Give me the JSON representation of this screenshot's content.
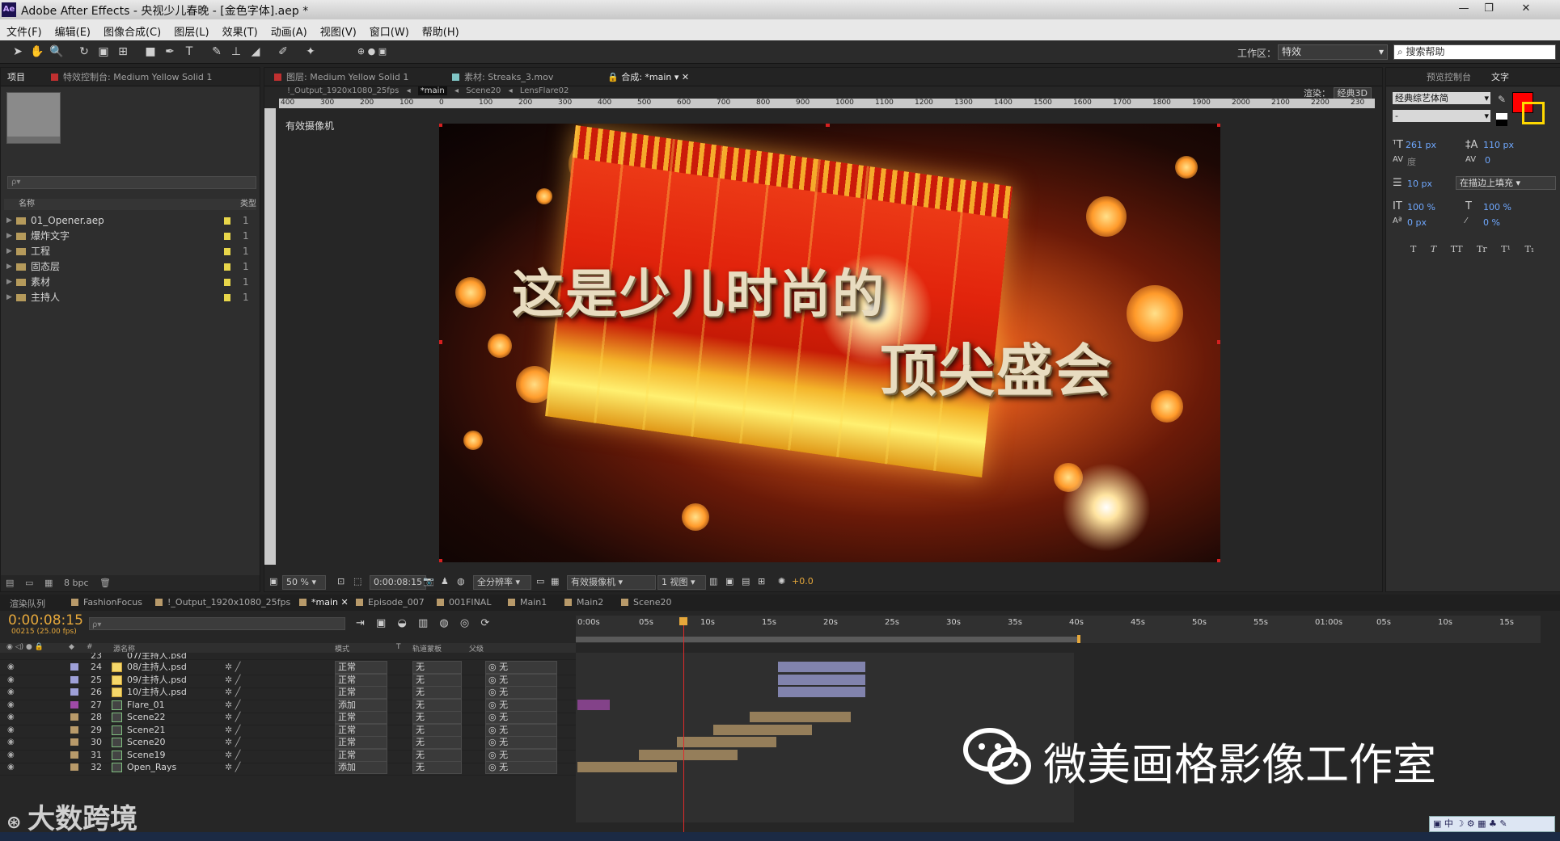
{
  "window": {
    "app_abbr": "Ae",
    "title": "Adobe After Effects - 央视少儿春晚 - [金色字体].aep *",
    "min": "—",
    "max": "❐",
    "close": "✕"
  },
  "menu": [
    "文件(F)",
    "编辑(E)",
    "图像合成(C)",
    "图层(L)",
    "效果(T)",
    "动画(A)",
    "视图(V)",
    "窗口(W)",
    "帮助(H)"
  ],
  "toolbar": {
    "workspace_label": "工作区：",
    "workspace_value": "特效",
    "help_search": "搜索帮助"
  },
  "project_panel": {
    "tab_project": "项目",
    "tab_effects": "特效控制台: Medium Yellow Solid 1",
    "search_placeholder": "ρ▾",
    "col_name": "名称",
    "col_type": "类型",
    "items": [
      {
        "name": "01_Opener.aep",
        "type": "1"
      },
      {
        "name": "爆炸文字",
        "type": "1"
      },
      {
        "name": "工程",
        "type": "1"
      },
      {
        "name": "固态层",
        "type": "1"
      },
      {
        "name": "素材",
        "type": "1"
      },
      {
        "name": "主持人",
        "type": "1"
      }
    ],
    "bpc": "8 bpc"
  },
  "viewer": {
    "tab_layer": "图层: Medium Yellow Solid 1",
    "tab_footage": "素材: Streaks_3.mov",
    "tab_comp": "合成: *main",
    "breadcrumbs": [
      "!_Output_1920x1080_25fps",
      "*main",
      "Scene20",
      "LensFlare02"
    ],
    "renderer_label": "渲染：",
    "renderer_value": "经典3D",
    "camera_label": "有效摄像机",
    "ruler_ticks": [
      "400",
      "300",
      "200",
      "100",
      "0",
      "100",
      "200",
      "300",
      "400",
      "500",
      "600",
      "700",
      "800",
      "900",
      "1000",
      "1100",
      "1200",
      "1300",
      "1400",
      "1500",
      "1600",
      "1700",
      "1800",
      "1900",
      "2000",
      "2100",
      "2200",
      "230"
    ],
    "headline_1": "这是少儿时尚的",
    "headline_2": "顶尖盛会",
    "zoom": "50 %",
    "timecode": "0:00:08:15",
    "resolution": "全分辨率",
    "camera": "有效摄像机",
    "views": "1 视图",
    "exposure": "+0.0"
  },
  "character_panel": {
    "tab_1": "预览控制台",
    "tab_2": "文字",
    "font": "经典综艺体简",
    "font_style": "-",
    "size": "261 px",
    "leading": "110 px",
    "kerning": "度",
    "tracking": "0",
    "stroke": "10 px",
    "stroke_mode": "在描边上填充",
    "vscale": "100 %",
    "hscale": "100 %",
    "baseline": "0 px",
    "tsume": "0 %",
    "styles": [
      "T",
      "T",
      "TT",
      "Tr",
      "T¹",
      "T₁"
    ],
    "fill_color": "#ff0000",
    "stroke_color": "#ffd800"
  },
  "timeline": {
    "tabs": [
      "渲染队列",
      "FashionFocus",
      "!_Output_1920x1080_25fps",
      "*main",
      "Episode_007",
      "001FINAL",
      "Main1",
      "Main2",
      "Scene20"
    ],
    "timecode": "0:00:08:15",
    "fps": "00215 (25.00 fps)",
    "header": {
      "name": "源名称",
      "mode": "模式",
      "t": "T",
      "trkmat": "轨道蒙板",
      "parent": "父级"
    },
    "ruler": [
      "0:00s",
      "05s",
      "10s",
      "15s",
      "20s",
      "25s",
      "30s",
      "35s",
      "40s",
      "45s",
      "50s",
      "55s",
      "01:00s",
      "05s",
      "10s",
      "15s"
    ],
    "layers": [
      {
        "num": "24",
        "name": "08/主持人.psd",
        "mode": "正常",
        "trk": "无",
        "parent": "无",
        "color": "#9ea0d8",
        "kind": "psd"
      },
      {
        "num": "25",
        "name": "09/主持人.psd",
        "mode": "正常",
        "trk": "无",
        "parent": "无",
        "color": "#9ea0d8",
        "kind": "psd"
      },
      {
        "num": "26",
        "name": "10/主持人.psd",
        "mode": "正常",
        "trk": "无",
        "parent": "无",
        "color": "#9ea0d8",
        "kind": "psd"
      },
      {
        "num": "27",
        "name": "Flare_01",
        "mode": "添加",
        "trk": "无",
        "parent": "无",
        "color": "#a04aa8",
        "kind": "comp"
      },
      {
        "num": "28",
        "name": "Scene22",
        "mode": "正常",
        "trk": "无",
        "parent": "无",
        "color": "#b89a6a",
        "kind": "comp"
      },
      {
        "num": "29",
        "name": "Scene21",
        "mode": "正常",
        "trk": "无",
        "parent": "无",
        "color": "#b89a6a",
        "kind": "comp"
      },
      {
        "num": "30",
        "name": "Scene20",
        "mode": "正常",
        "trk": "无",
        "parent": "无",
        "color": "#b89a6a",
        "kind": "comp"
      },
      {
        "num": "31",
        "name": "Scene19",
        "mode": "正常",
        "trk": "无",
        "parent": "无",
        "color": "#b89a6a",
        "kind": "comp"
      },
      {
        "num": "32",
        "name": "Open_Rays",
        "mode": "添加",
        "trk": "无",
        "parent": "无",
        "color": "#b89a6a",
        "kind": "comp"
      }
    ],
    "partial_top": {
      "num": "23",
      "name": "07/主持人.psd"
    },
    "watermark": "微美画格影像工作室",
    "watermark2": "大数跨境"
  },
  "tray": "中 ☽ ⚙ ▦ ♣ ✎"
}
